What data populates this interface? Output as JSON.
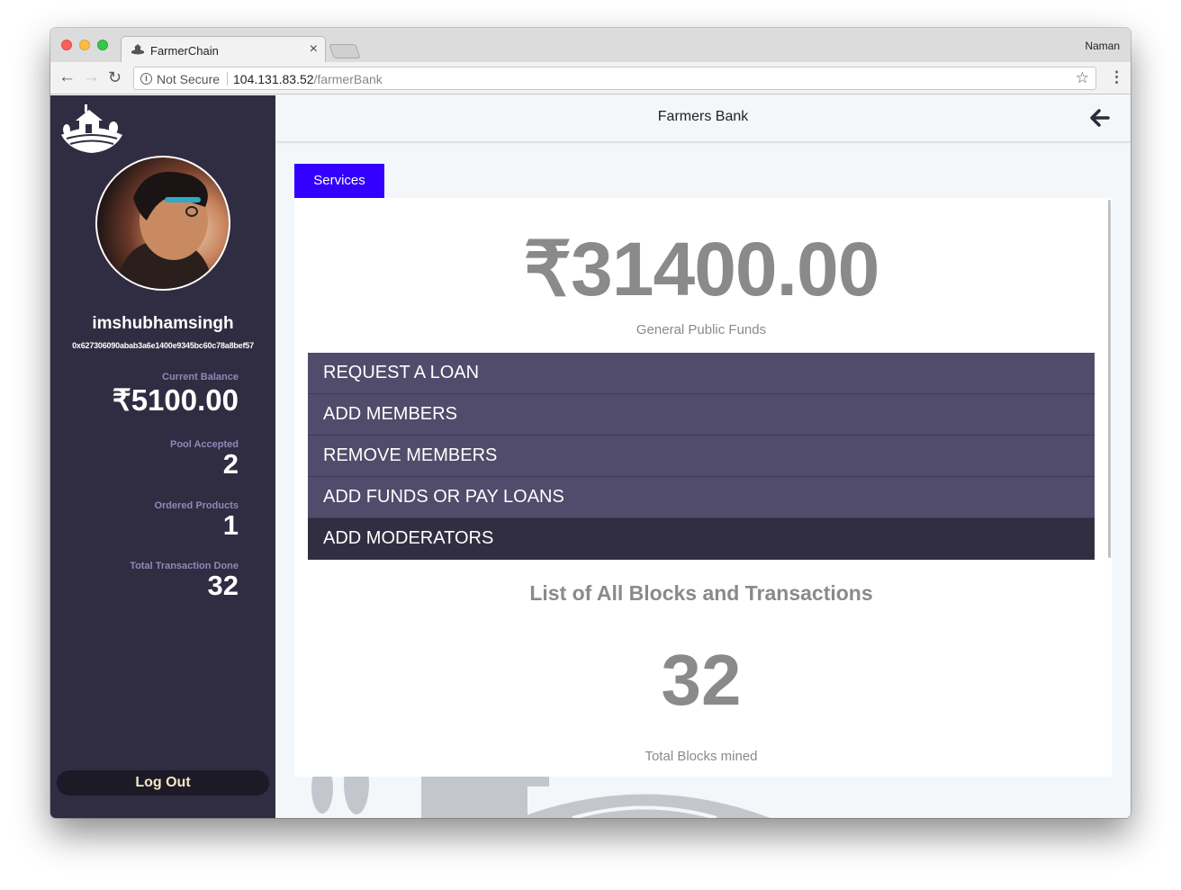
{
  "browser": {
    "tab_title": "FarmerChain",
    "tab_close": "×",
    "profile_name": "Naman",
    "security_label": "Not Secure",
    "url_host": "104.131.83.52",
    "url_path": "/farmerBank",
    "nav": {
      "back": "←",
      "forward": "→",
      "reload": "↻",
      "star": "☆",
      "menu": "⋮"
    }
  },
  "sidebar": {
    "username": "imshubhamsingh",
    "address": "0x627306090abab3a6e1400e9345bc60c78a8bef57",
    "stats": [
      {
        "label": "Current Balance",
        "value": "₹5100.00"
      },
      {
        "label": "Pool Accepted",
        "value": "2"
      },
      {
        "label": "Ordered Products",
        "value": "1"
      },
      {
        "label": "Total Transaction Done",
        "value": "32"
      }
    ],
    "logout_label": "Log Out"
  },
  "header": {
    "title": "Farmers Bank"
  },
  "services": {
    "tab_label": "Services",
    "funds_amount": "₹31400.00",
    "funds_label": "General Public Funds",
    "menu_items": [
      "REQUEST A LOAN",
      "ADD MEMBERS",
      "REMOVE MEMBERS",
      "ADD FUNDS OR PAY LOANS",
      "ADD MODERATORS"
    ],
    "active_item": "ADD MODERATORS",
    "blocks_title": "List of All Blocks and Transactions",
    "blocks_count": "32",
    "blocks_label": "Total Blocks mined"
  },
  "colors": {
    "sidebar_bg": "#302c41",
    "menu_bg": "#514c6b",
    "menu_active_bg": "#322e42",
    "services_tab": "#3300ff",
    "stat_label": "#8f89b8"
  },
  "icons": {
    "logo": "farm-logo-icon",
    "back": "arrow-left-icon",
    "info": "info-icon"
  }
}
